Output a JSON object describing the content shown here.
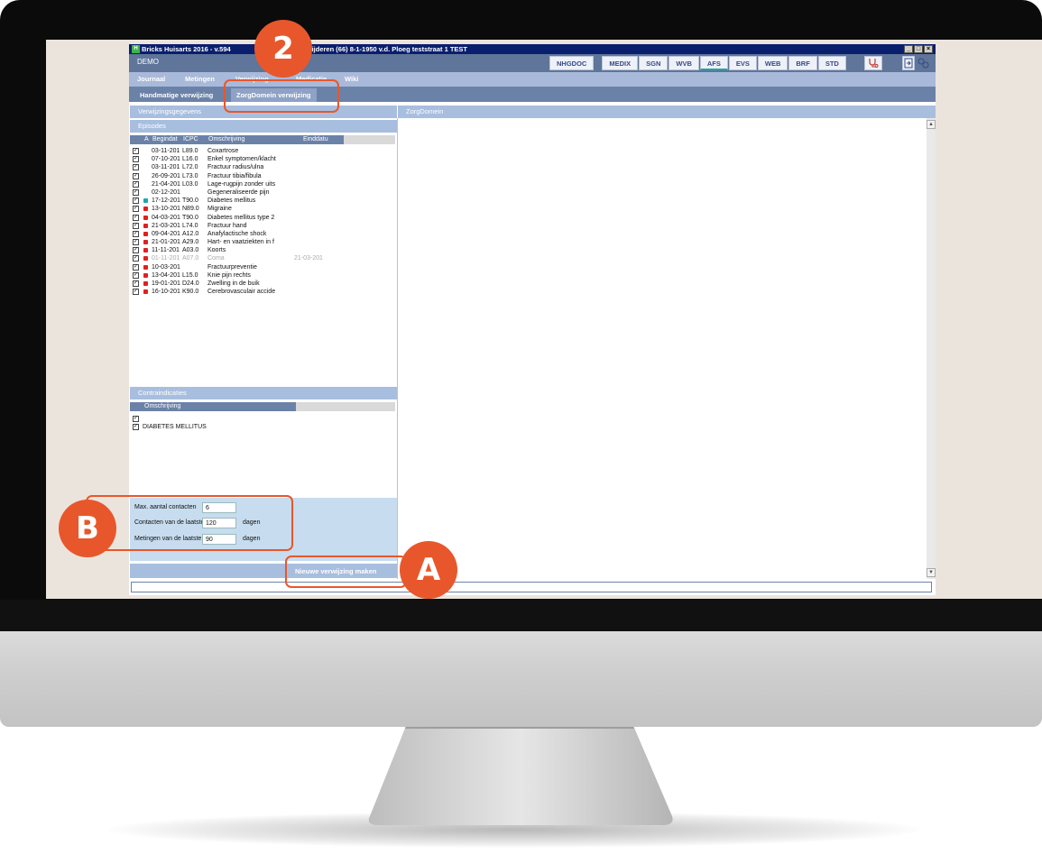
{
  "window": {
    "title": "Bricks Huisarts 2016 - v.594",
    "title_tail": "erwijderen (66) 8-1-1950 v.d. Ploeg teststraat 1  TEST",
    "app_icon": "H",
    "controls": [
      "_",
      "□",
      "×"
    ]
  },
  "practice": {
    "name": "DEMO"
  },
  "module_tabs": [
    "NHGDOC",
    "MEDIX",
    "SGN",
    "WVB",
    "AFS",
    "EVS",
    "WEB",
    "BRF",
    "STD"
  ],
  "icon_buttons": [
    "stethoscope-icon",
    "export-icon",
    "link-icon"
  ],
  "nav": [
    "Journaal",
    "Metingen",
    "Verwijzing",
    "Medicatie",
    "Wiki"
  ],
  "subtabs": [
    "Handmatige verwijzing",
    "ZorgDomein verwijzing"
  ],
  "left_pane": {
    "header": "Verwijzingsgegevens",
    "episodes": {
      "title": "Episodes",
      "columns": [
        "A",
        "Begindat",
        "ICPC",
        "Omschrijving",
        "Einddatu"
      ],
      "rows": [
        {
          "checked": true,
          "status": "",
          "date": "03-11-201",
          "icpc": "L89.0",
          "desc": "Coxartrose",
          "end": ""
        },
        {
          "checked": true,
          "status": "",
          "date": "07-10-201",
          "icpc": "L16.0",
          "desc": "Enkel symptomen/klacht",
          "end": ""
        },
        {
          "checked": true,
          "status": "",
          "date": "03-11-201",
          "icpc": "L72.0",
          "desc": "Fractuur radius/ulna",
          "end": ""
        },
        {
          "checked": true,
          "status": "",
          "date": "26-09-201",
          "icpc": "L73.0",
          "desc": "Fractuur tibia/fibula",
          "end": ""
        },
        {
          "checked": true,
          "status": "",
          "date": "21-04-201",
          "icpc": "L03.0",
          "desc": "Lage-rugpijn zonder uits",
          "end": ""
        },
        {
          "checked": true,
          "status": "",
          "date": "02-12-201",
          "icpc": "",
          "desc": "Gegeneraliseerde pijn",
          "end": ""
        },
        {
          "checked": true,
          "status": "teal",
          "date": "17-12-201",
          "icpc": "T90.0",
          "desc": "Diabetes mellitus",
          "end": ""
        },
        {
          "checked": true,
          "status": "red",
          "date": "13-10-201",
          "icpc": "N89.0",
          "desc": "Migraine",
          "end": ""
        },
        {
          "checked": true,
          "status": "red",
          "date": "04-03-201",
          "icpc": "T90.0",
          "desc": "Diabetes mellitus type 2",
          "end": ""
        },
        {
          "checked": true,
          "status": "red",
          "date": "21-03-201",
          "icpc": "L74.0",
          "desc": "Fractuur hand",
          "end": ""
        },
        {
          "checked": true,
          "status": "red",
          "date": "09-04-201",
          "icpc": "A12.0",
          "desc": "Anafylactische shock",
          "end": ""
        },
        {
          "checked": true,
          "status": "red",
          "date": "21-01-201",
          "icpc": "A29.0",
          "desc": "Hart- en vaatziekten in f",
          "end": ""
        },
        {
          "checked": true,
          "status": "red",
          "date": "11-11-201",
          "icpc": "A03.0",
          "desc": "Koorts",
          "end": ""
        },
        {
          "checked": true,
          "status": "red",
          "date": "01-11-201",
          "icpc": "A07.0",
          "desc": "Coma",
          "end": "21-03-201",
          "ended": true
        },
        {
          "checked": true,
          "status": "red",
          "date": "10-03-201",
          "icpc": "",
          "desc": "Fractuurpreventie",
          "end": ""
        },
        {
          "checked": true,
          "status": "red",
          "date": "13-04-201",
          "icpc": "L15.0",
          "desc": "Knie pijn rechts",
          "end": ""
        },
        {
          "checked": true,
          "status": "red",
          "date": "19-01-201",
          "icpc": "D24.0",
          "desc": "Zwelling in de buik",
          "end": ""
        },
        {
          "checked": true,
          "status": "red",
          "date": "16-10-201",
          "icpc": "K90.0",
          "desc": "Cerebrovasculair accide",
          "end": ""
        }
      ]
    },
    "contraindications": {
      "title": "Contraindicaties",
      "column": "Omschrijving",
      "rows": [
        {
          "checked": true,
          "desc": ""
        },
        {
          "checked": true,
          "desc": "DIABETES MELLITUS"
        }
      ]
    },
    "settings": {
      "max_contacts_label": "Max. aantal contacten",
      "max_contacts": "6",
      "contacts_label": "Contacten van de laatste",
      "contacts_days": "120",
      "measurements_label": "Metingen van de laatste",
      "measurements_days": "90",
      "unit": "dagen"
    },
    "new_button": "Nieuwe verwijzing maken"
  },
  "right_pane": {
    "header": "ZorgDomein"
  },
  "callouts": [
    "2",
    "B",
    "A"
  ],
  "colors": {
    "accent": "#e8572b",
    "title_bar": "#0a1e6e",
    "red_status": "#e02020",
    "teal_status": "#1fa7b0"
  }
}
